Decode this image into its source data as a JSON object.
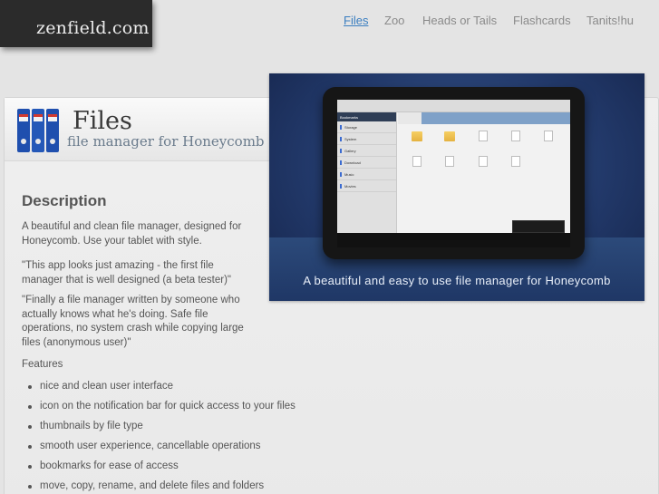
{
  "site": {
    "logo": "zenfield.com"
  },
  "nav": {
    "items": [
      {
        "label": "Files",
        "active": true
      },
      {
        "label": "Zoo",
        "active": false
      },
      {
        "label": "Heads or Tails",
        "active": false
      },
      {
        "label": "Flashcards",
        "active": false
      },
      {
        "label": "Tanits!hu",
        "active": false
      }
    ]
  },
  "app": {
    "title": "Files",
    "subtitle": "file manager for Honeycomb"
  },
  "description": {
    "heading": "Description",
    "paragraphs": [
      "A beautiful and clean file manager, designed for Honeycomb. Use your tablet with style.",
      "\"This app looks just amazing - the first file manager that is well designed (a beta tester)\"",
      "\"Finally a file manager written by someone who actually knows what he's doing. Safe file operations, no system crash while copying large files (anonymous user)\"",
      "Features"
    ],
    "features": [
      "nice and clean user interface",
      "icon on the notification bar for quick access to your files",
      "thumbnails by file type",
      "smooth user experience, cancellable operations",
      "bookmarks for ease of access",
      "move, copy, rename, and delete files and folders"
    ]
  },
  "banner": {
    "caption": "A beautiful and easy to use file manager for Honeycomb",
    "screen": {
      "sidebar_head": "Bookmarks",
      "sidebar_items": [
        "Storage",
        "System",
        "Gallery",
        "Download",
        "Music",
        "Movies"
      ]
    }
  },
  "colors": {
    "nav_active": "#3a7ec0",
    "nav_inactive": "#8a8a8a",
    "logo_bg": "#2b2b2b",
    "banner_bg": "#22396a"
  }
}
